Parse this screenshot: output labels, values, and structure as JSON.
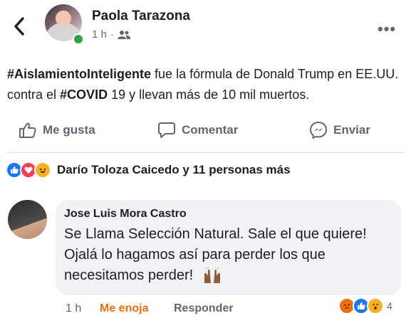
{
  "post": {
    "author": "Paola Tarazona",
    "time": "1 h",
    "audience_icon": "friends-icon",
    "text_tag1": "#AislamientoInteligente",
    "text_part1": " fue la fórmula de Donald Trump en EE.UU. contra el ",
    "text_tag2": "#COVID",
    "text_part2": " 19 y llevan más de 10 mil muertos."
  },
  "actions": {
    "like": "Me gusta",
    "comment": "Comentar",
    "send": "Enviar"
  },
  "reactions_summary": {
    "icons": [
      "like-reaction-icon",
      "love-reaction-icon",
      "haha-reaction-icon"
    ],
    "text": "Darío Toloza Caicedo y 11 personas más"
  },
  "comment": {
    "author": "Jose Luis Mora Castro",
    "text": "Se Llama Selección Natural. Sale el que quiere! Ojalá lo hagamos así para perder los que necesitamos perder!",
    "emoji_icon": "raising-hands-icon",
    "time": "1 h",
    "reaction_label": "Me enoja",
    "reply_label": "Responder",
    "reaction_icons": [
      "angry-reaction-icon",
      "like-reaction-icon",
      "wow-reaction-icon"
    ],
    "reaction_count": "4"
  },
  "colors": {
    "facebook_blue": "#1877f2",
    "angry_orange": "#e9710f",
    "online_green": "#31a24c"
  }
}
